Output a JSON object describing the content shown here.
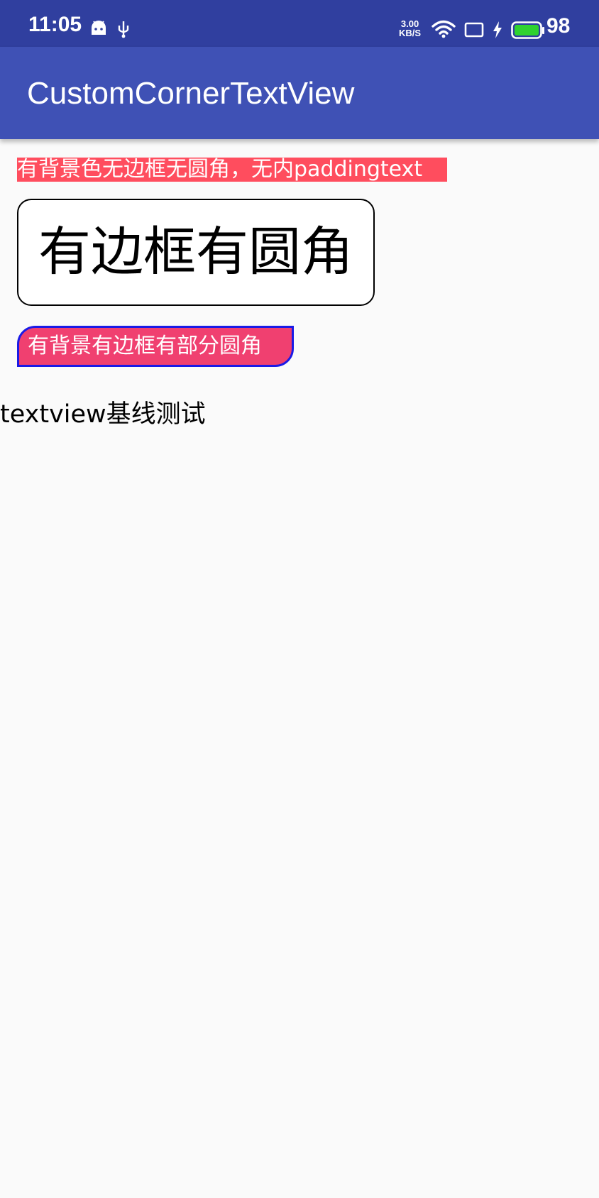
{
  "status_bar": {
    "time": "11:05",
    "net_speed_value": "3.00",
    "net_speed_unit": "KB/S",
    "battery_level": "98",
    "background_color": "#303f9f",
    "icons": [
      "android-icon",
      "usb-icon",
      "wifi-icon",
      "screen-icon",
      "charging-icon",
      "battery-icon"
    ]
  },
  "app_bar": {
    "title": "CustomCornerTextView",
    "background_color": "#3f51b5"
  },
  "content": {
    "label_background_no_border": "有背景色无边框无圆角，无内paddingtext",
    "label_border_rounded": "有边框有圆角",
    "label_background_border_partial": "有背景有边框有部分圆角",
    "label_baseline_test": "textview基线测试"
  },
  "colors": {
    "red_background": "#ff4d5e",
    "pink_background": "#f04070",
    "blue_border": "#1a1ae6",
    "page_background": "#fafafa"
  }
}
